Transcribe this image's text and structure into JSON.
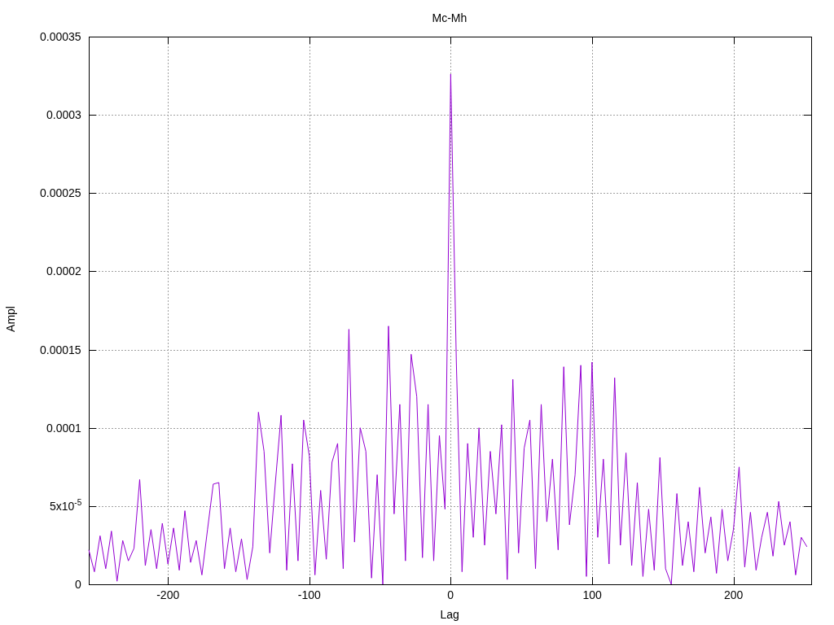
{
  "chart_data": {
    "type": "line",
    "title": "Mc-Mh",
    "xlabel": "Lag",
    "ylabel": "Ampl",
    "grid": true,
    "xlim": [
      -256,
      255
    ],
    "ylim": [
      0,
      0.00035
    ],
    "xticks": [
      -200,
      -100,
      0,
      100,
      200
    ],
    "yticks": [
      0,
      {
        "value": 5e-05,
        "label": "5x10$^{-5}$"
      },
      0.0001,
      0.00015,
      0.0002,
      0.00025,
      0.0003,
      0.00035
    ],
    "x": [
      -256,
      -252,
      -248,
      -244,
      -240,
      -236,
      -232,
      -228,
      -224,
      -220,
      -216,
      -212,
      -208,
      -204,
      -200,
      -196,
      -192,
      -188,
      -184,
      -180,
      -176,
      -172,
      -168,
      -164,
      -160,
      -156,
      -152,
      -148,
      -144,
      -140,
      -136,
      -132,
      -128,
      -124,
      -120,
      -116,
      -112,
      -108,
      -104,
      -100,
      -96,
      -92,
      -88,
      -84,
      -80,
      -76,
      -72,
      -68,
      -64,
      -60,
      -56,
      -52,
      -48,
      -44,
      -40,
      -36,
      -32,
      -28,
      -24,
      -20,
      -16,
      -12,
      -8,
      -4,
      0,
      4,
      8,
      12,
      16,
      20,
      24,
      28,
      32,
      36,
      40,
      44,
      48,
      52,
      56,
      60,
      64,
      68,
      72,
      76,
      80,
      84,
      88,
      92,
      96,
      100,
      104,
      108,
      112,
      116,
      120,
      124,
      128,
      132,
      136,
      140,
      144,
      148,
      152,
      156,
      160,
      164,
      168,
      172,
      176,
      180,
      184,
      188,
      192,
      196,
      200,
      204,
      208,
      212,
      216,
      220,
      224,
      228,
      232,
      236,
      240,
      244,
      248,
      252
    ],
    "series": [
      {
        "color": "#9400d3",
        "values": [
          2.2e-05,
          8e-06,
          3.1e-05,
          1e-05,
          3.4e-05,
          2e-06,
          2.8e-05,
          1.5e-05,
          2.3e-05,
          6.7e-05,
          1.2e-05,
          3.5e-05,
          1e-05,
          3.9e-05,
          1.3e-05,
          3.6e-05,
          9e-06,
          4.7e-05,
          1.4e-05,
          2.8e-05,
          6e-06,
          3.5e-05,
          6.4e-05,
          6.5e-05,
          1e-05,
          3.6e-05,
          8e-06,
          2.9e-05,
          3e-06,
          2.4e-05,
          0.00011,
          8.5e-05,
          2e-05,
          6.5e-05,
          0.000108,
          9e-06,
          7.7e-05,
          1.5e-05,
          0.000105,
          8.2e-05,
          6e-06,
          6e-05,
          1.6e-05,
          7.8e-05,
          9e-05,
          1e-05,
          0.000163,
          2.7e-05,
          0.0001,
          8.5e-05,
          4e-06,
          7e-05,
          0,
          0.000165,
          4.5e-05,
          0.000115,
          1.5e-05,
          0.000147,
          0.00012,
          1.7e-05,
          0.000115,
          1.5e-05,
          9.5e-05,
          4.8e-05,
          0.000326,
          0.000142,
          8e-06,
          9e-05,
          3e-05,
          0.0001,
          2.5e-05,
          8.5e-05,
          4.5e-05,
          0.000102,
          3e-06,
          0.000131,
          2e-05,
          8.7e-05,
          0.000105,
          1e-05,
          0.000115,
          4e-05,
          8e-05,
          2.2e-05,
          0.000139,
          3.8e-05,
          7e-05,
          0.00014,
          5e-06,
          0.000142,
          3e-05,
          8e-05,
          1.3e-05,
          0.000132,
          2.5e-05,
          8.4e-05,
          1.2e-05,
          6.5e-05,
          5e-06,
          4.8e-05,
          9e-06,
          8.1e-05,
          1e-05,
          0,
          5.8e-05,
          1.2e-05,
          4e-05,
          8e-06,
          6.2e-05,
          2e-05,
          4.3e-05,
          7e-06,
          4.8e-05,
          1.5e-05,
          3.5e-05,
          7.5e-05,
          1.1e-05,
          4.6e-05,
          9e-06,
          3e-05,
          4.6e-05,
          1.8e-05,
          5.3e-05,
          2.5e-05,
          4e-05,
          6e-06,
          3e-05,
          2.4e-05
        ]
      }
    ]
  }
}
